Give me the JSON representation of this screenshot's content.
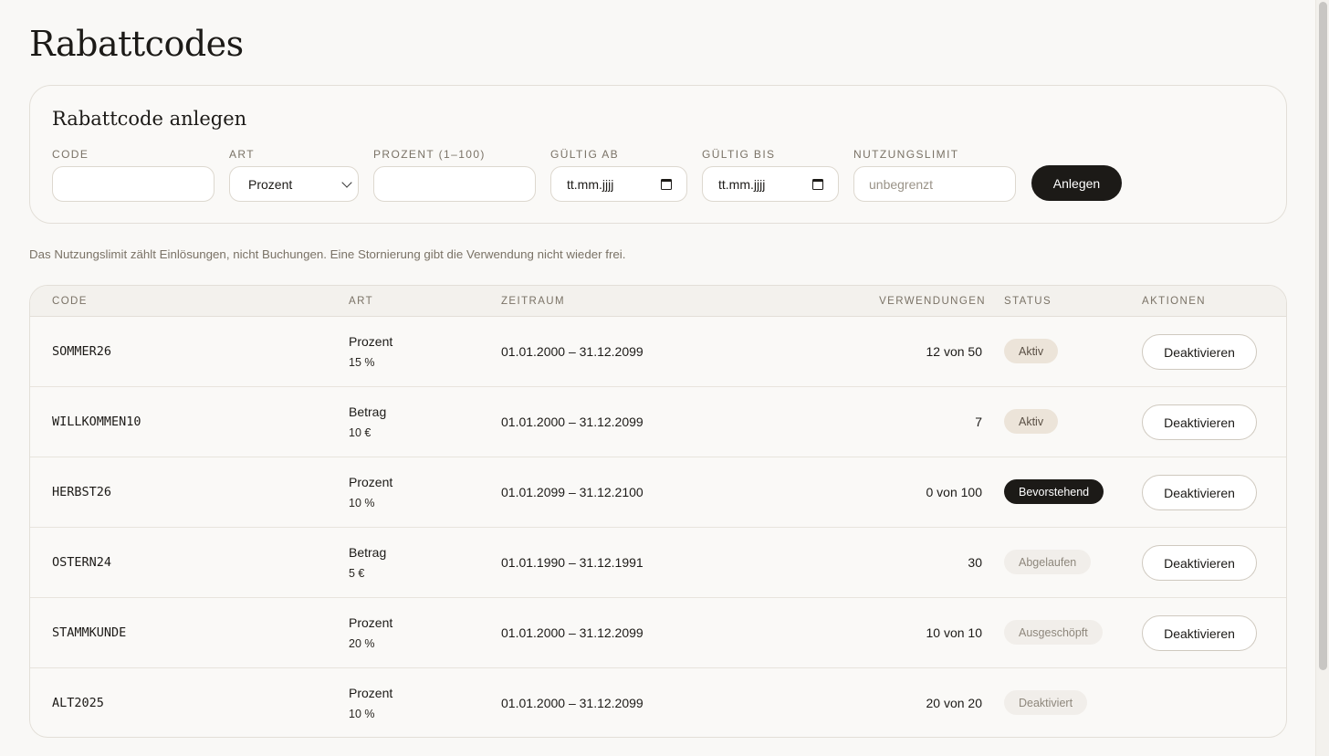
{
  "page": {
    "title": "Rabattcodes"
  },
  "create": {
    "title": "Rabattcode anlegen",
    "labels": {
      "code": "Code",
      "art": "Art",
      "prozent": "Prozent (1–100)",
      "gueltig_ab": "Gültig ab",
      "gueltig_bis": "Gültig bis",
      "nutzungslimit": "Nutzungslimit"
    },
    "values": {
      "code": "",
      "art": "Prozent",
      "prozent": "",
      "gueltig_ab": "tt.mm.jjjj",
      "gueltig_bis": "tt.mm.jjjj"
    },
    "placeholders": {
      "nutzungslimit": "unbegrenzt"
    },
    "submit_label": "Anlegen"
  },
  "note": "Das Nutzungslimit zählt Einlösungen, nicht Buchungen. Eine Stornierung gibt die Verwendung nicht wieder frei.",
  "table": {
    "headers": {
      "code": "Code",
      "art": "Art",
      "zeitraum": "Zeitraum",
      "verwendungen": "Verwendungen",
      "status": "Status",
      "aktionen": "Aktionen"
    },
    "rows": [
      {
        "code": "SOMMER26",
        "type": "Prozent",
        "amount": "15 %",
        "period": "01.01.2000 – 31.12.2099",
        "uses": "12 von 50",
        "status": "Aktiv",
        "status_style": "aktiv",
        "action": "Deaktivieren"
      },
      {
        "code": "WILLKOMMEN10",
        "type": "Betrag",
        "amount": "10 €",
        "period": "01.01.2000 – 31.12.2099",
        "uses": "7",
        "status": "Aktiv",
        "status_style": "aktiv",
        "action": "Deaktivieren"
      },
      {
        "code": "HERBST26",
        "type": "Prozent",
        "amount": "10 %",
        "period": "01.01.2099 – 31.12.2100",
        "uses": "0 von 100",
        "status": "Bevorstehend",
        "status_style": "bevorstehend",
        "action": "Deaktivieren"
      },
      {
        "code": "OSTERN24",
        "type": "Betrag",
        "amount": "5 €",
        "period": "01.01.1990 – 31.12.1991",
        "uses": "30",
        "status": "Abgelaufen",
        "status_style": "muted",
        "action": "Deaktivieren"
      },
      {
        "code": "STAMMKUNDE",
        "type": "Prozent",
        "amount": "20 %",
        "period": "01.01.2000 – 31.12.2099",
        "uses": "10 von 10",
        "status": "Ausgeschöpft",
        "status_style": "muted",
        "action": "Deaktivieren"
      },
      {
        "code": "ALT2025",
        "type": "Prozent",
        "amount": "10 %",
        "period": "01.01.2000 – 31.12.2099",
        "uses": "20 von 20",
        "status": "Deaktiviert",
        "status_style": "muted",
        "action": ""
      }
    ]
  },
  "colors": {
    "accent_dark": "#1c1a17",
    "badge_active": "#ece4d9",
    "badge_muted": "#f1eeea",
    "background": "#f9f8f6"
  }
}
